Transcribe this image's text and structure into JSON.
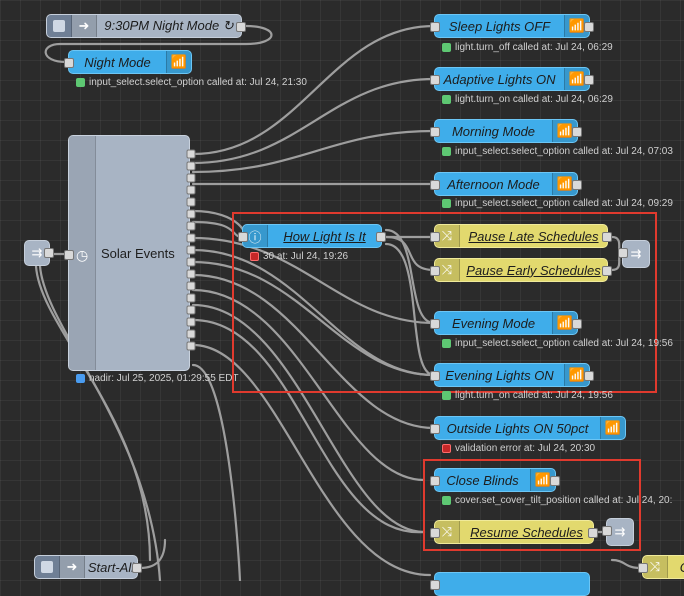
{
  "colors": {
    "blue_node": "#3fadea",
    "yellow_node": "#e2d96e",
    "grey_node": "#a8b4c4",
    "highlight": "#e03a2e",
    "status_ok": "#5ec873",
    "status_err": "#c62828"
  },
  "nodes": {
    "inject_night": {
      "label": "9:30PM Night Mode ↻",
      "icon": "arrow-right-icon"
    },
    "night_mode": {
      "label": "Night Mode",
      "icon": "wifi-router-icon",
      "status": "input_select.select_option called at: Jul 24, 21:30"
    },
    "sleep_lights": {
      "label": "Sleep Lights OFF",
      "icon": "wifi-router-icon",
      "status": "light.turn_off called at: Jul 24, 06:29"
    },
    "adaptive_lights": {
      "label": "Adaptive Lights ON",
      "icon": "wifi-router-icon",
      "status": "light.turn_on called at: Jul 24, 06:29"
    },
    "morning_mode": {
      "label": "Morning Mode",
      "icon": "wifi-router-icon",
      "status": "input_select.select_option called at: Jul 24, 07:03"
    },
    "afternoon_mode": {
      "label": "Afternoon Mode",
      "icon": "wifi-router-icon",
      "status": "input_select.select_option called at: Jul 24, 09:29"
    },
    "solar_events": {
      "label": "Solar Events",
      "icon": "clock-icon",
      "status": "nadir: Jul 25, 2025, 01:29:55 EDT"
    },
    "how_light": {
      "label": "How Light Is It",
      "icon": "info-icon",
      "status": "30 at: Jul 24, 19:26"
    },
    "pause_late": {
      "label": "Pause Late Schedules",
      "icon": "shuffle-icon"
    },
    "pause_early": {
      "label": "Pause Early Schedules",
      "icon": "shuffle-icon"
    },
    "evening_mode": {
      "label": "Evening Mode",
      "icon": "wifi-router-icon",
      "status": "input_select.select_option called at: Jul 24, 19:56"
    },
    "evening_lights": {
      "label": "Evening Lights ON",
      "icon": "wifi-router-icon",
      "status": "light.turn_on called at: Jul 24, 19:56"
    },
    "outside_lights": {
      "label": "Outside Lights ON 50pct",
      "icon": "wifi-router-icon",
      "status": "validation error at: Jul 24, 20:30"
    },
    "close_blinds": {
      "label": "Close Blinds",
      "icon": "wifi-router-icon",
      "status": "cover.set_cover_tilt_position called at: Jul 24, 20:"
    },
    "resume_schedules": {
      "label": "Resume Schedules",
      "icon": "shuffle-icon"
    },
    "start_all": {
      "label": "Start-All",
      "icon": "arrow-right-icon"
    },
    "bottom_right_partial": {
      "label": "C",
      "icon": "shuffle-icon"
    }
  }
}
